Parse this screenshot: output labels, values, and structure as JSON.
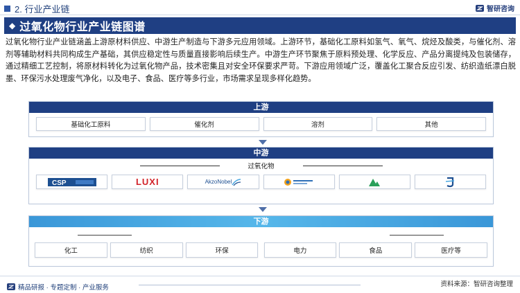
{
  "header": {
    "section": "2. 行业产业链",
    "brand": "智研咨询"
  },
  "title": "过氧化物行业产业链图谱",
  "description": "过氧化物行业产业链涵盖上游原材料供应、中游生产制造与下游多元应用领域。上游环节，基础化工原料如氢气、氧气、烷烃及酸类，与催化剂、溶剂等辅助材料共同构成生产基础，其供应稳定性与质量直接影响后续生产。中游生产环节聚焦于原料预处理、化学反应、产品分离提纯及包装储存，通过精细工艺控制，将原材料转化为过氧化物产品，技术密集且对安全环保要求严苛。下游应用领域广泛，覆盖化工聚合反应引发、纺织造纸漂白脱墨、环保污水处理废气净化，以及电子、食品、医疗等多行业，市场需求呈现多样化趋势。",
  "upstream": {
    "title": "上游",
    "items": [
      "基础化工原料",
      "催化剂",
      "溶剂",
      "其他"
    ]
  },
  "midstream": {
    "title": "中游",
    "subtitle": "过氧化物",
    "logos": [
      {
        "name": "CSP logo",
        "text": "CSP"
      },
      {
        "name": "LUXI logo",
        "text": "LUXI"
      },
      {
        "name": "AkzoNobel logo",
        "text": "AkzoNobel"
      },
      {
        "name": "company logo 4",
        "text": ""
      },
      {
        "name": "company logo 5",
        "text": ""
      },
      {
        "name": "company logo 6",
        "text": ""
      }
    ]
  },
  "downstream": {
    "title": "下游",
    "items": [
      "化工",
      "纺织",
      "环保",
      "电力",
      "食品",
      "医疗等"
    ]
  },
  "footer": {
    "left": "精品研报 · 专题定制 · 产业服务",
    "source": "资料来源：智研咨询整理"
  },
  "colors": {
    "navy": "#1f3f83",
    "light_blue": "#4aa8e2",
    "luxi_red": "#d2232a",
    "akzo_blue": "#1d4f91",
    "green": "#2aa05a"
  }
}
